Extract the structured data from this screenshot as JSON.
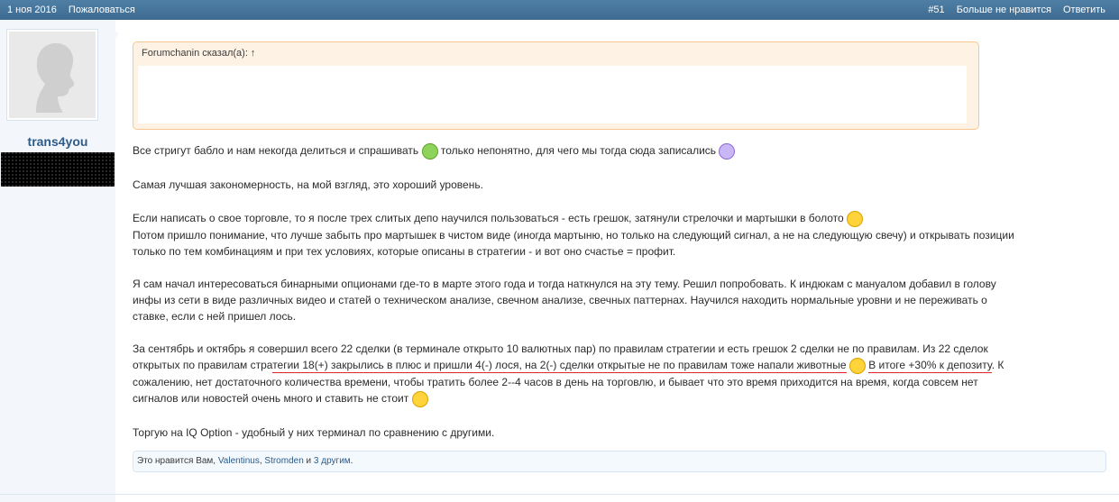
{
  "header": {
    "date": "1 ноя 2016",
    "report": "Пожаловаться",
    "post_number": "#51",
    "unlike": "Больше не нравится",
    "reply": "Ответить"
  },
  "user": {
    "name": "trans4you"
  },
  "quote": {
    "author_line": "Forumchanin сказал(а): ↑"
  },
  "message": {
    "p1a": "Все стригут бабло и нам некогда делиться и спрашивать",
    "p1b": "только непонятно, для чего мы тогда сюда записались",
    "p2": "Самая лучшая закономерность, на мой взгляд, это хороший уровень.",
    "p3a": "Если написать о свое торговле, то я после трех слитых депо научился пользоваться - есть грешок, затянули стрелочки и мартышки в болото",
    "p3b": "Потом пришло понимание, что лучше забыть про мартышек в чистом виде (иногда мартыню, но только на следующий сигнал, а не на следующую свечу) и открывать позиции",
    "p3c": "только по тем комбинациям и при тех условиях, которые описаны в стратегии - и вот оно счастье = профит.",
    "p4a": "Я сам начал интересоваться бинарными опционами где-то в марте этого года и тогда наткнулся на эту тему. Решил попробовать. К индюкам с мануалом добавил в голову",
    "p4b": "инфы из сети в виде различных видео и статей о техническом анализе, свечном анализе, свечных паттернах. Научился находить нормальные уровни и не переживать о",
    "p4c": "ставке, если с ней пришел лось.",
    "p5a": "За сентябрь и октябрь я совершил всего 22 сделки (в терминале открыто 10 валютных пар) по правилам стратегии и есть грешок 2 сделки не по правилам. Из 22 сделок",
    "p5b_pre": "открытых по правилам стра",
    "p5b_u1": "тегии 18(+) закрылись в плюс и пришли 4(-) лося, на 2(-) сделки открытые не по правилам тоже напали животные",
    "p5b_u2": "В итоге +30% к депозиту",
    "p5b_post": ". К",
    "p5c": "сожалению, нет достаточного количества времени, чтобы тратить более 2--4 часов в день на торговлю, и бывает что это время приходится на время, когда совсем нет",
    "p5d": "сигналов или новостей очень много и ставить не стоит",
    "p6": "Торгую на IQ Option - удобный у них терминал по сравнению с другими."
  },
  "likes": {
    "prefix": "Это нравится Вам,",
    "user1": "Valentinus",
    "user2": "Stromden",
    "mid": "и",
    "others": "3 другим",
    "suffix": "."
  },
  "smileys": [
    "grin-icon",
    "nerd-icon",
    "smile-icon",
    "smile-icon",
    "smile-icon"
  ]
}
